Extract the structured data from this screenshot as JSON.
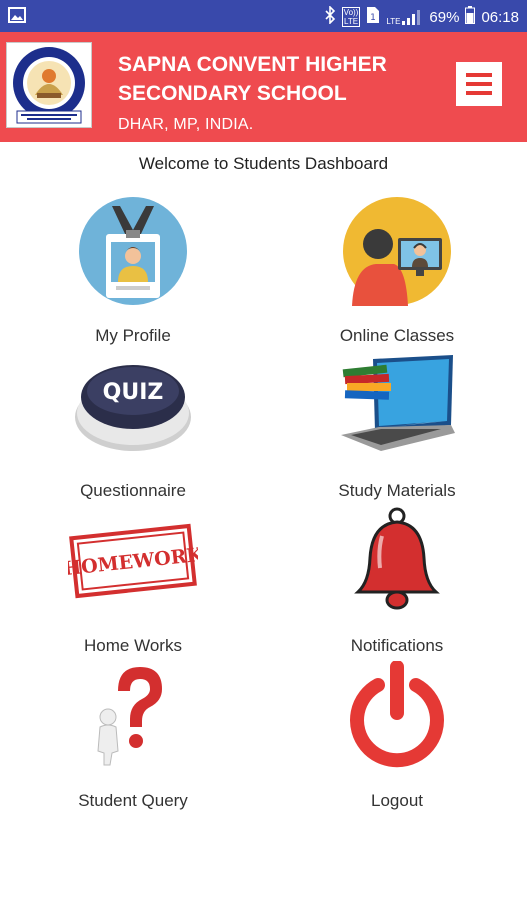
{
  "statusbar": {
    "battery": "69%",
    "time": "06:18",
    "net_top": "Vo))",
    "net_bottom": "LTE",
    "lte_label": "LTE"
  },
  "header": {
    "title_line1": "SAPNA CONVENT HIGHER",
    "title_line2": "SECONDARY SCHOOL",
    "subtitle": "DHAR, MP, INDIA.",
    "accent": "#ef4b4f"
  },
  "welcome": "Welcome to Students Dashboard",
  "tiles": {
    "profile": "My Profile",
    "online_classes": "Online Classes",
    "questionnaire": "Questionnaire",
    "study_materials": "Study Materials",
    "home_works": "Home Works",
    "notifications": "Notifications",
    "student_query": "Student Query",
    "logout": "Logout"
  },
  "images": {
    "quiz_text": "QUIZ",
    "homework_text": "HOMEWORK"
  }
}
